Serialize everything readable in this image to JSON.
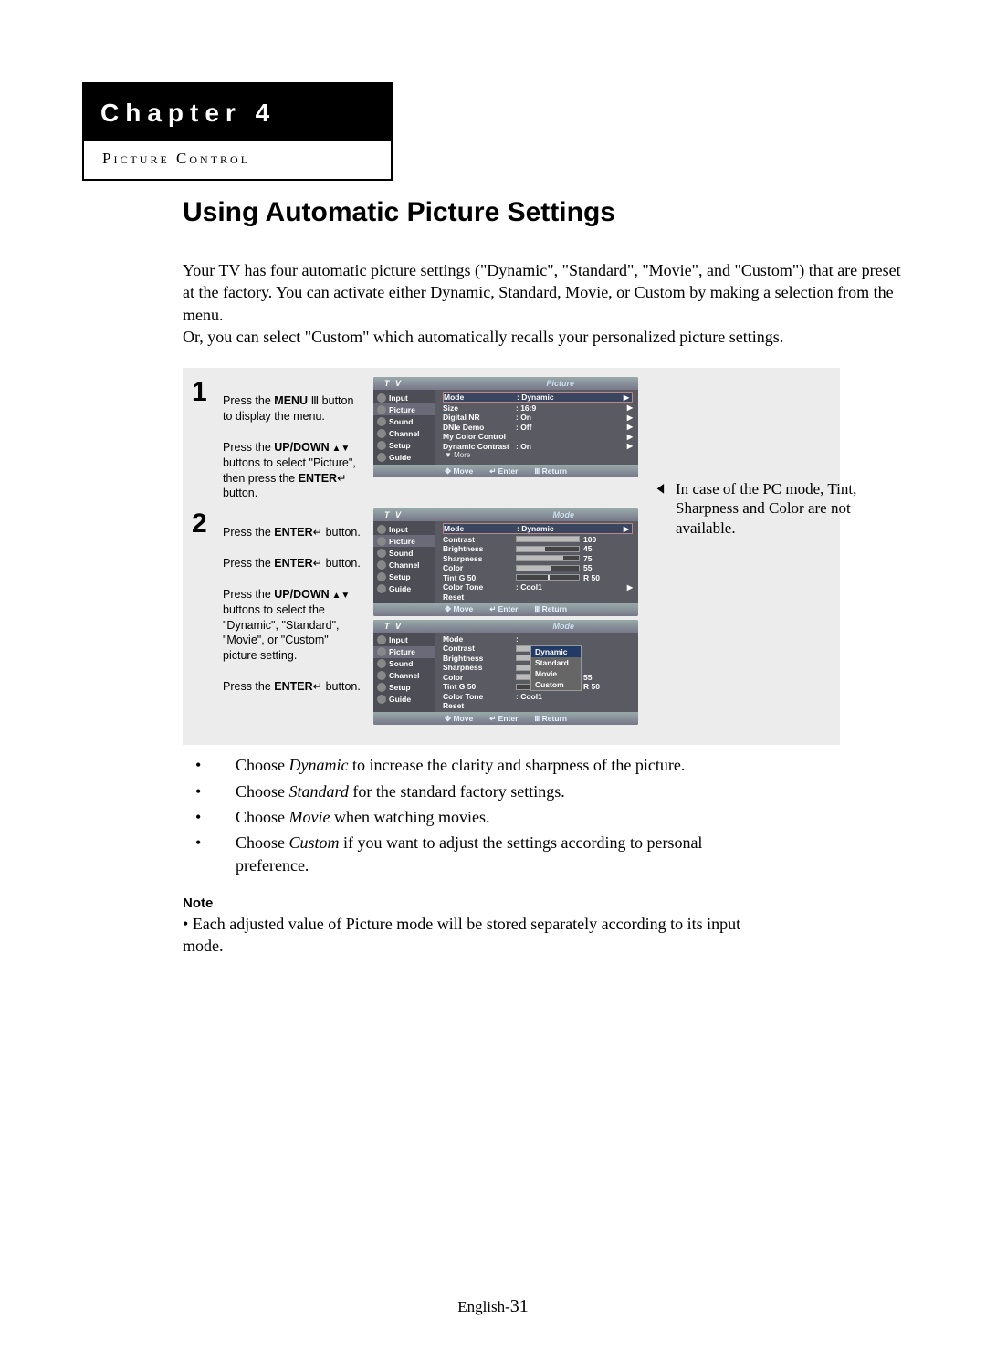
{
  "chapter": {
    "label": "Chapter 4",
    "subtitle": "Picture Control"
  },
  "title": "Using Automatic Picture Settings",
  "intro_p1": "Your TV has four automatic picture settings (\"Dynamic\", \"Standard\", \"Movie\", and \"Custom\") that are preset at the factory. You can activate either Dynamic, Standard, Movie, or Custom by making a selection from the menu.",
  "intro_p2": "Or, you can select \"Custom\" which automatically recalls your personalized picture settings.",
  "steps": {
    "s1": {
      "num": "1",
      "line1a": "Press the ",
      "line1b": "MENU",
      "line1c": " button to display the menu.",
      "line2a": "Press the ",
      "line2b": "UP/DOWN",
      "line2c": " buttons to select \"Picture\", then press the ",
      "line2d": "ENTER",
      "line2e": " button."
    },
    "s2": {
      "num": "2",
      "line1a": "Press the ",
      "line1b": "ENTER",
      "line1c": " button.",
      "line2a": "Press the ",
      "line2b": "ENTER",
      "line2c": " button.",
      "line3a": "Press the ",
      "line3b": "UP/DOWN",
      "line3c": " buttons to select the \"Dynamic\", \"Standard\", \"Movie\", or \"Custom\" picture setting.",
      "line4a": "Press the ",
      "line4b": "ENTER",
      "line4c": " button."
    }
  },
  "osd_common": {
    "tv": "T V",
    "left_items": [
      "Input",
      "Picture",
      "Sound",
      "Channel",
      "Setup",
      "Guide"
    ],
    "footer": {
      "move": "Move",
      "enter": "Enter",
      "return": "Return"
    }
  },
  "osd1": {
    "header_right": "Picture",
    "rows": [
      {
        "k": "Mode",
        "v": ": Dynamic",
        "hl": true,
        "tri": true
      },
      {
        "k": "Size",
        "v": ": 16:9",
        "tri": true
      },
      {
        "k": "Digital NR",
        "v": ": On",
        "tri": true
      },
      {
        "k": "DNIe Demo",
        "v": ": Off",
        "tri": true
      },
      {
        "k": "My Color Control",
        "v": "",
        "tri": true
      },
      {
        "k": "Dynamic Contrast",
        "v": ": On",
        "tri": true
      }
    ],
    "more": "▼ More"
  },
  "osd2": {
    "header_right": "Mode",
    "rows": [
      {
        "k": "Mode",
        "v": ": Dynamic",
        "hl": true,
        "tri": true
      },
      {
        "k": "Contrast",
        "bar": 100,
        "val": "100"
      },
      {
        "k": "Brightness",
        "bar": 45,
        "val": "45"
      },
      {
        "k": "Sharpness",
        "bar": 75,
        "val": "75"
      },
      {
        "k": "Color",
        "bar": 55,
        "val": "55"
      },
      {
        "k": "Tint  G 50",
        "bar": 50,
        "val": "R 50",
        "tick": true
      },
      {
        "k": "Color Tone",
        "v": ": Cool1",
        "tri": true
      },
      {
        "k": "Reset",
        "v": ""
      }
    ]
  },
  "osd3": {
    "header_right": "Mode",
    "rows": [
      {
        "k": "Mode",
        "v": ":"
      },
      {
        "k": "Contrast",
        "bar": 100,
        "val": ""
      },
      {
        "k": "Brightness",
        "bar": 45,
        "val": ""
      },
      {
        "k": "Sharpness",
        "bar": 75,
        "val": ""
      },
      {
        "k": "Color",
        "bar": 55,
        "val": "55"
      },
      {
        "k": "Tint  G 50",
        "bar": 50,
        "val": "R 50",
        "tick": true
      },
      {
        "k": "Color Tone",
        "v": ": Cool1"
      },
      {
        "k": "Reset",
        "v": ""
      }
    ],
    "popup": [
      "Dynamic",
      "Standard",
      "Movie",
      "Custom"
    ]
  },
  "side_note": "In case of the PC mode, Tint, Sharpness and Color are not available.",
  "bullets": [
    {
      "pre": "Choose ",
      "em": "Dynamic",
      "post": " to increase the clarity and sharpness of the picture."
    },
    {
      "pre": "Choose ",
      "em": "Standard",
      "post": " for the standard factory settings."
    },
    {
      "pre": "Choose ",
      "em": "Movie",
      "post": " when watching movies."
    },
    {
      "pre": "Choose ",
      "em": "Custom",
      "post": " if you want to adjust the settings according to personal preference."
    }
  ],
  "note": {
    "label": "Note",
    "text": "Each adjusted value of Picture mode will be stored separately according to its input mode."
  },
  "footer": {
    "lang": "English-",
    "page": "31"
  }
}
